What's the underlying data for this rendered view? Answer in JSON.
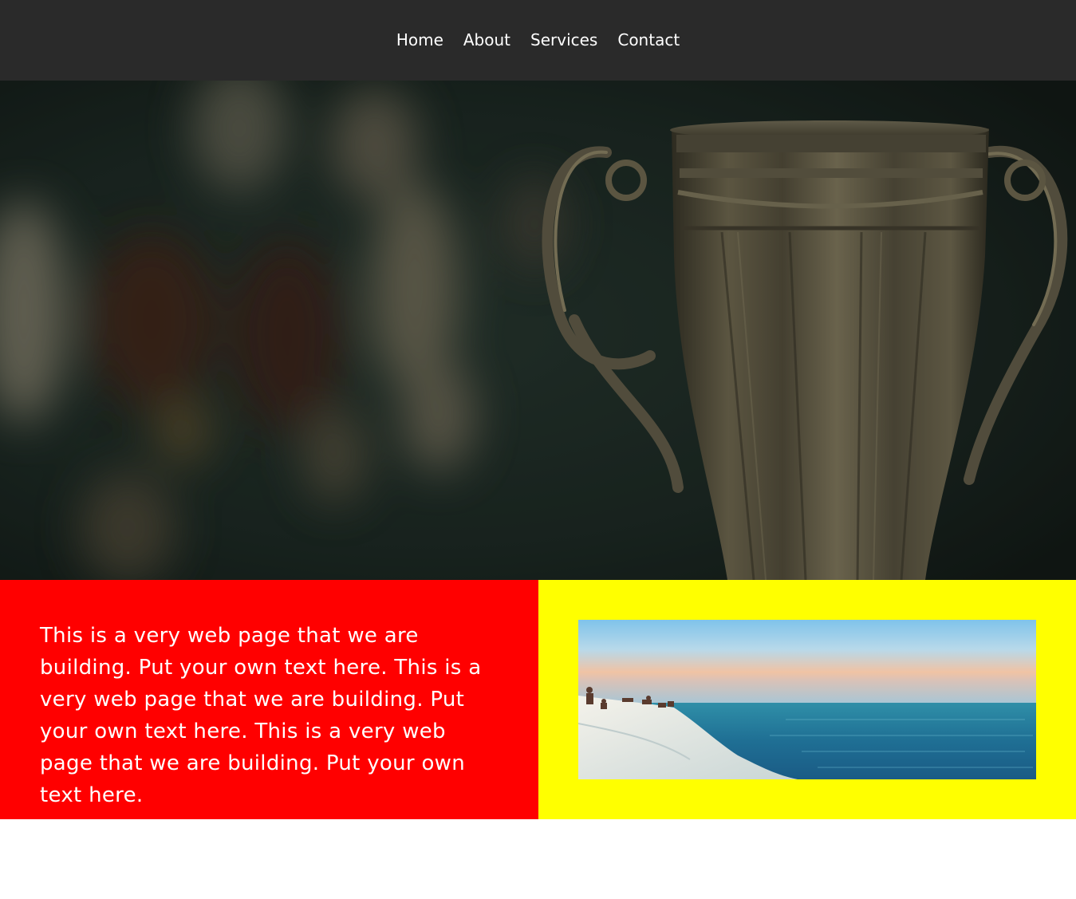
{
  "nav": {
    "items": [
      {
        "label": "Home"
      },
      {
        "label": "About"
      },
      {
        "label": "Services"
      },
      {
        "label": "Contact"
      }
    ]
  },
  "hero": {
    "image": "trophy-cup-photo"
  },
  "content": {
    "body_text": "This is a very web page that we are building. Put your own text here. This is a very web page that we are building. Put your own text here. This is a very web page that we are building. Put your own text here.",
    "photo": "seaside-cliff-sunset-photo"
  },
  "colors": {
    "nav_bg": "#2a2a2a",
    "left_panel_bg": "#ff0000",
    "right_panel_bg": "#ffff00",
    "text": "#ffffff"
  }
}
